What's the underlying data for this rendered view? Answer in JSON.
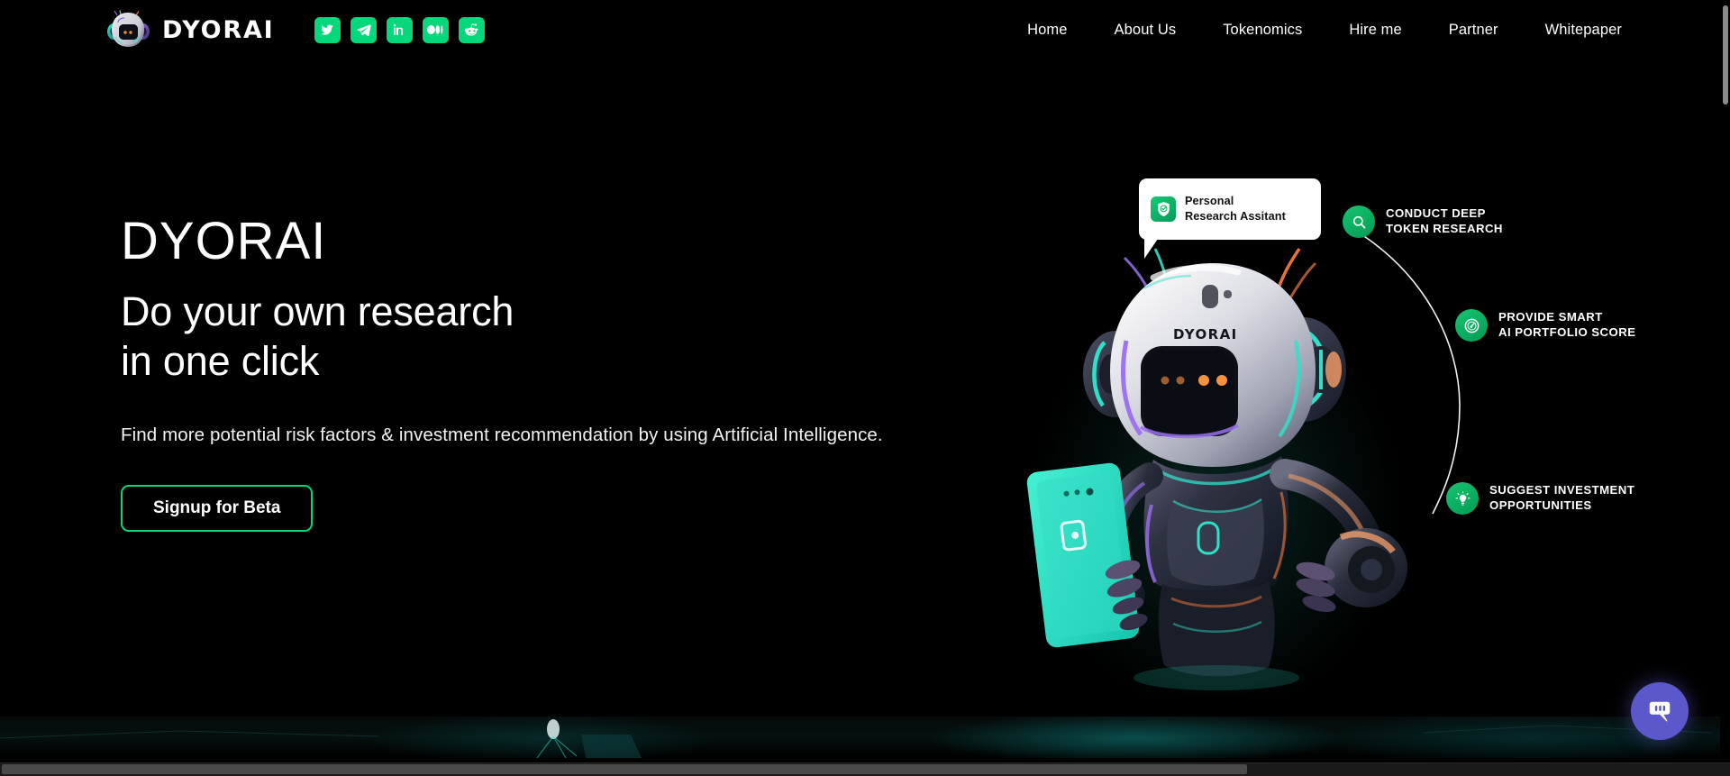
{
  "brand": {
    "name": "DYORAI",
    "logo_icon": "robot-head-icon"
  },
  "socials": [
    {
      "name": "twitter",
      "label": "Twitter",
      "icon": "twitter-icon"
    },
    {
      "name": "telegram",
      "label": "Telegram",
      "icon": "telegram-icon"
    },
    {
      "name": "linkedin",
      "label": "LinkedIn",
      "icon": "linkedin-icon"
    },
    {
      "name": "medium",
      "label": "Medium",
      "icon": "medium-icon"
    },
    {
      "name": "reddit",
      "label": "Reddit",
      "icon": "reddit-icon"
    }
  ],
  "nav": {
    "items": [
      {
        "label": "Home"
      },
      {
        "label": "About Us"
      },
      {
        "label": "Tokenomics"
      },
      {
        "label": "Hire me"
      },
      {
        "label": "Partner"
      },
      {
        "label": "Whitepaper"
      }
    ]
  },
  "hero": {
    "title": "DYORAI",
    "subtitle_line1": "Do your own research",
    "subtitle_line2": "in one click",
    "description": "Find more potential risk factors & investment recommendation by using Artificial Intelligence.",
    "cta_label": "Signup for Beta"
  },
  "assistant_bubble": {
    "line1": "Personal",
    "line2": "Research Assitant",
    "icon": "shield-check-icon"
  },
  "robot": {
    "helmet_label": "DYORAI",
    "alt": "3d-robot-holding-phone"
  },
  "callouts": [
    {
      "icon": "search-icon",
      "label": "CONDUCT DEEP\nTOKEN RESEARCH"
    },
    {
      "icon": "gauge-icon",
      "label": "PROVIDE SMART\nAI PORTFOLIO SCORE"
    },
    {
      "icon": "lightbulb-icon",
      "label": "SUGGEST INVESTMENT\nOPPORTUNITIES"
    }
  ],
  "chat_widget": {
    "icon": "chat-bubble-icon",
    "label": "Open chat"
  },
  "colors": {
    "accent_green": "#06D77B",
    "badge_green": "#16C56F",
    "background": "#000000",
    "chat_purple": "#5B58CC",
    "robot_cyan": "#2FE0C8",
    "robot_purple": "#8D6BE0",
    "robot_orange": "#F27A3A"
  }
}
